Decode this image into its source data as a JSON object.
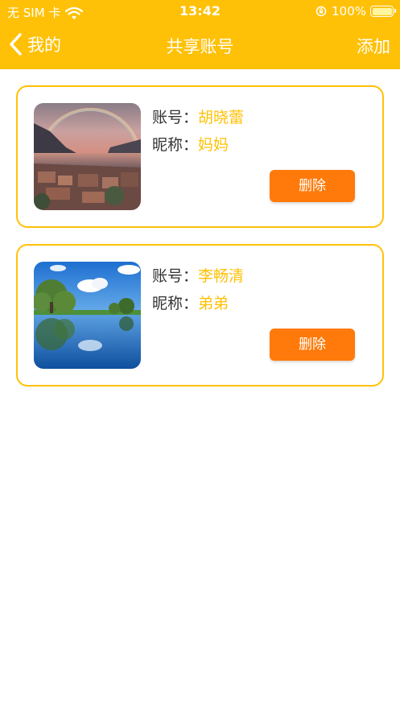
{
  "status_bar": {
    "carrier": "无 SIM 卡",
    "time": "13:42",
    "battery": "100%"
  },
  "navbar": {
    "back_label": "我的",
    "title": "共享账号",
    "action_label": "添加"
  },
  "accounts": [
    {
      "account_label": "账号：",
      "account_value": "胡晓蕾",
      "nickname_label": "昵称：",
      "nickname_value": "妈妈",
      "delete_label": "删除"
    },
    {
      "account_label": "账号：",
      "account_value": "李畅清",
      "nickname_label": "昵称：",
      "nickname_value": "弟弟",
      "delete_label": "删除"
    }
  ],
  "colors": {
    "brand": "#FFC107",
    "delete_button": "#FF7A0A"
  }
}
